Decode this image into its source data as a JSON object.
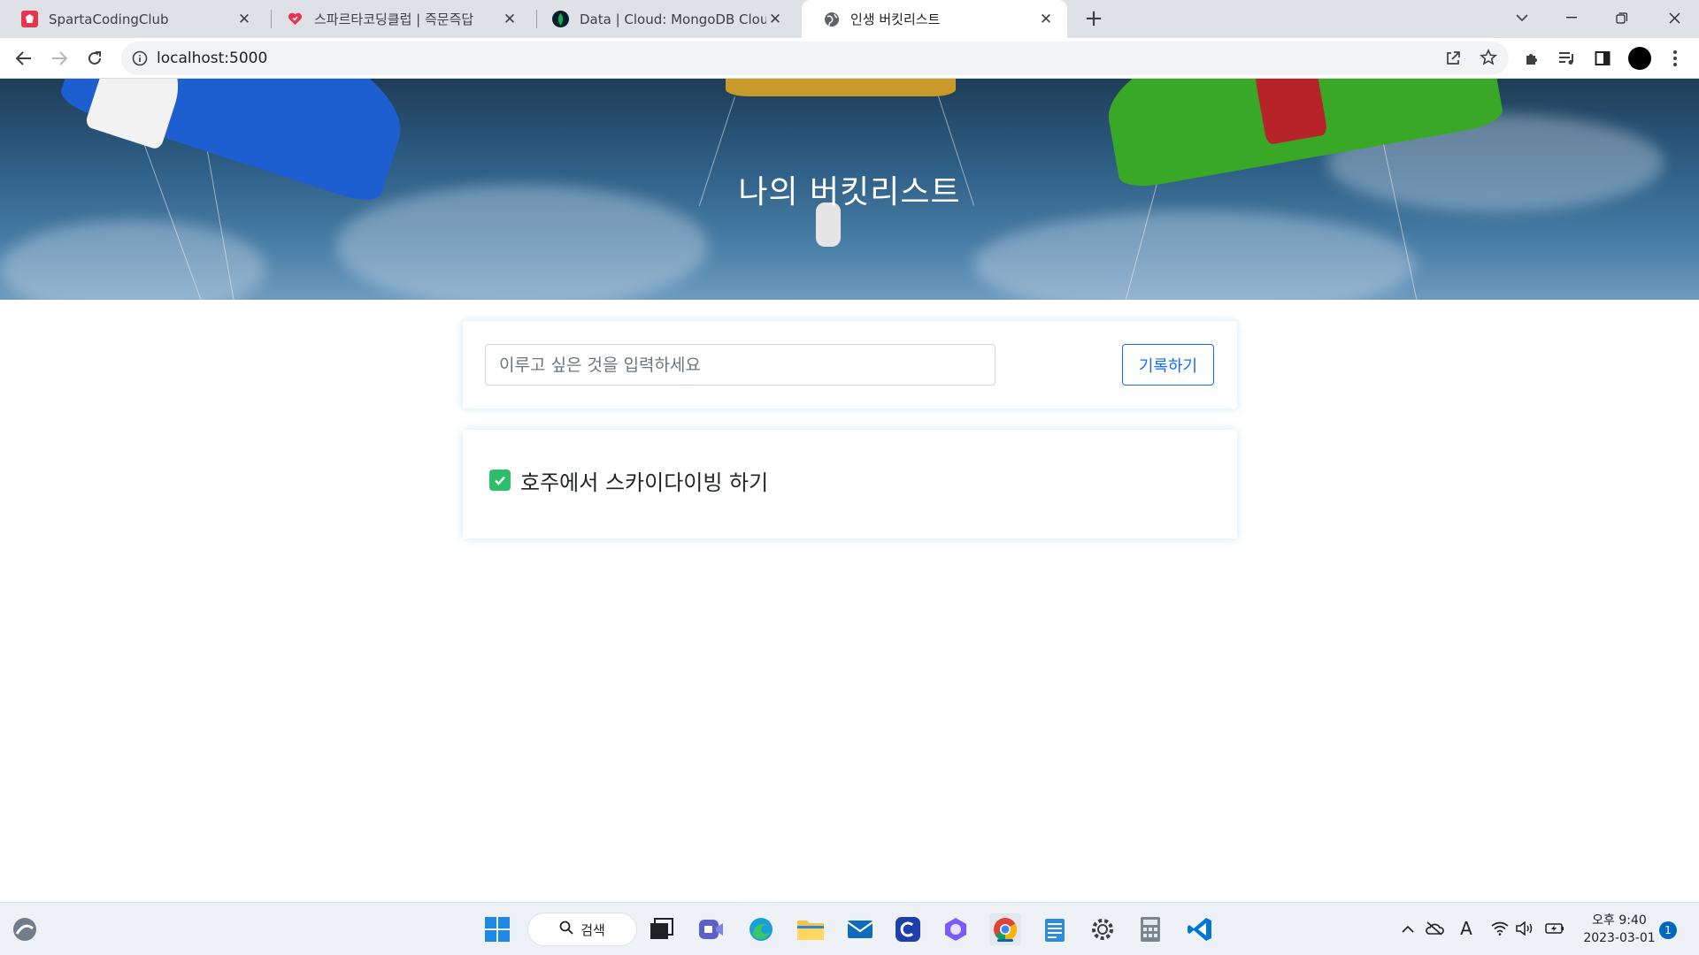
{
  "browser": {
    "tabs": [
      {
        "title": "SpartaCodingClub",
        "icon": "sparta-logo-icon",
        "active": false
      },
      {
        "title": "스파르타코딩클럽 | 즉문즉답",
        "icon": "heart-logo-icon",
        "active": false
      },
      {
        "title": "Data | Cloud: MongoDB Cloud",
        "icon": "mongodb-leaf-icon",
        "active": false
      },
      {
        "title": "인생 버킷리스트",
        "icon": "globe-icon",
        "active": true
      }
    ],
    "address": "localhost:5000"
  },
  "page": {
    "hero_title": "나의 버킷리스트",
    "input_placeholder": "이루고 싶은 것을 입력하세요",
    "record_button": "기록하기",
    "items": [
      {
        "text": "호주에서 스카이다이빙 하기",
        "done": true
      }
    ]
  },
  "taskbar": {
    "search_label": "검색",
    "clock_time": "오후 9:40",
    "clock_date": "2023-03-01",
    "notification_count": "1"
  },
  "colors": {
    "accent": "#0d6efd",
    "check": "#2bbf6a",
    "hero": "#2e5f86"
  }
}
